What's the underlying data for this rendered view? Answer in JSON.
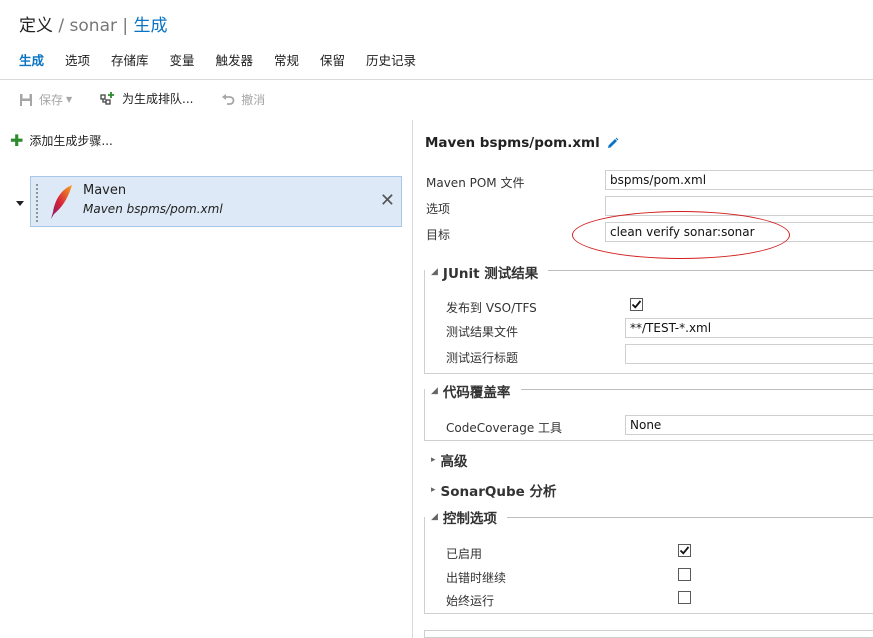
{
  "header": {
    "breadcrumb_root": "定义",
    "breadcrumb_sep1": "/",
    "breadcrumb_def": "sonar",
    "breadcrumb_sep2": "|",
    "breadcrumb_current": "生成"
  },
  "tabs": [
    {
      "label": "生成",
      "active": true
    },
    {
      "label": "选项"
    },
    {
      "label": "存储库"
    },
    {
      "label": "变量"
    },
    {
      "label": "触发器"
    },
    {
      "label": "常规"
    },
    {
      "label": "保留"
    },
    {
      "label": "历史记录"
    }
  ],
  "toolbar": {
    "save_label": "保存",
    "queue_label": "为生成排队...",
    "undo_label": "撤消"
  },
  "left": {
    "add_step_label": "添加生成步骤...",
    "step": {
      "title": "Maven",
      "subtitle": "Maven bspms/pom.xml"
    }
  },
  "task": {
    "title": "Maven bspms/pom.xml",
    "fields": {
      "pom_label": "Maven POM 文件",
      "pom_value": "bspms/pom.xml",
      "options_label": "选项",
      "options_value": "",
      "goals_label": "目标",
      "goals_value": "clean verify sonar:sonar"
    },
    "junit": {
      "title": "JUnit 测试结果",
      "publish_label": "发布到 VSO/TFS",
      "publish_checked": true,
      "results_label": "测试结果文件",
      "results_value": "**/TEST-*.xml",
      "run_title_label": "测试运行标题",
      "run_title_value": ""
    },
    "coverage": {
      "title": "代码覆盖率",
      "tool_label": "CodeCoverage 工具",
      "tool_value": "None"
    },
    "advanced_title": "高级",
    "sonarqube_title": "SonarQube 分析",
    "control": {
      "title": "控制选项",
      "enabled_label": "已启用",
      "enabled_checked": true,
      "continue_label": "出错时继续",
      "continue_checked": false,
      "always_label": "始终运行",
      "always_checked": false
    }
  },
  "colors": {
    "accent": "#0a73c4",
    "selection": "#dde9f6",
    "annotation": "#d21e1e",
    "add_icon": "#2e8b2e"
  },
  "icons": {
    "save": "floppy-disk-icon",
    "queue": "build-queue-icon",
    "undo": "undo-arrow-icon",
    "add": "plus-icon",
    "maven": "maven-feather-icon",
    "edit": "pencil-icon",
    "remove": "close-icon"
  }
}
